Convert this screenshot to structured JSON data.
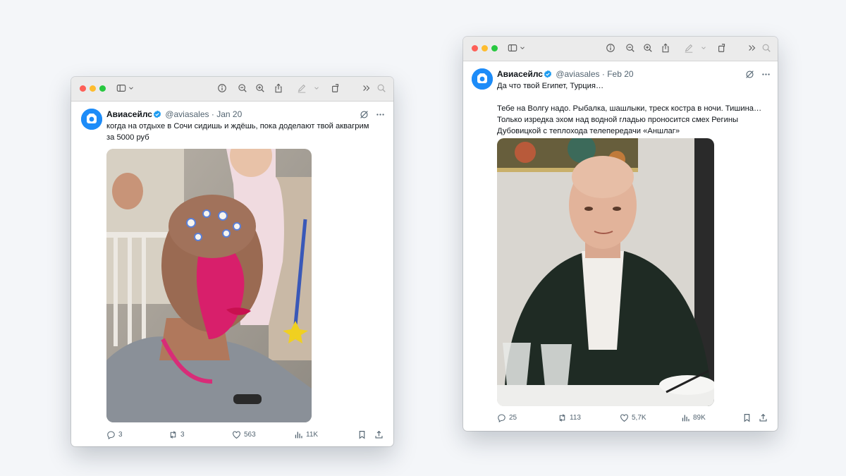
{
  "tweets": [
    {
      "author": "Авиасейлс",
      "handle": "@aviasales",
      "date": "Jan 20",
      "text": "когда на отдыхе в Сочи сидишь и ждёшь, пока доделают твой аквагрим\nза 5000 руб",
      "stats": {
        "replies": "3",
        "reposts": "3",
        "likes": "563",
        "views": "11K"
      }
    },
    {
      "author": "Авиасейлс",
      "handle": "@aviasales",
      "date": "Feb 20",
      "text": "Да что твой Египет, Турция…\n\nТебе на Волгу надо. Рыбалка, шашлыки, треск костра в ночи. Тишина…\nТолько изредка эхом над водной гладью проносится смех Регины\nДубовицкой с теплохода телепередачи «Аншлаг»",
      "stats": {
        "replies": "25",
        "reposts": "113",
        "likes": "5,7K",
        "views": "89K"
      }
    }
  ],
  "colors": {
    "accent": "#1d9bf0",
    "avatar": "#1d8cf8",
    "text": "#0f1419",
    "muted": "#536471"
  },
  "icons": [
    "sidebar-icon",
    "info-icon",
    "zoom-out-icon",
    "zoom-in-icon",
    "share-icon",
    "markup-icon",
    "rotate-icon",
    "more-tools-icon",
    "search-icon",
    "grok-icon",
    "more-icon",
    "reply-icon",
    "repost-icon",
    "like-icon",
    "views-icon",
    "bookmark-icon",
    "share-post-icon"
  ]
}
